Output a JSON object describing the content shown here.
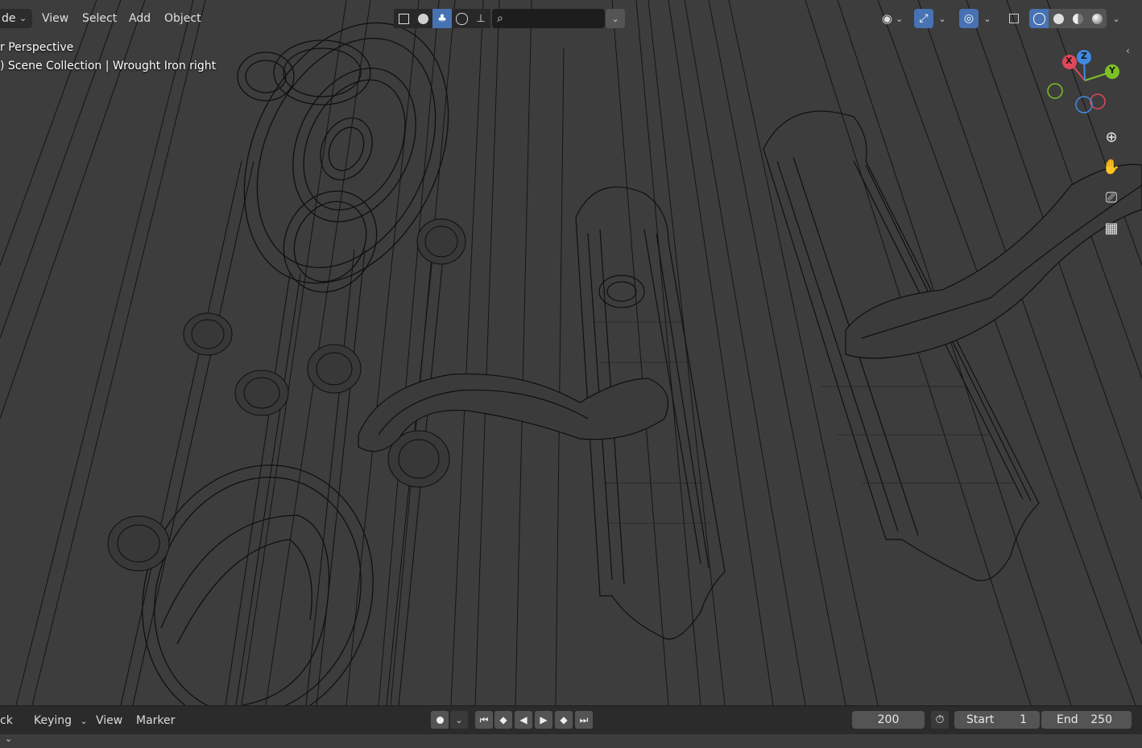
{
  "header": {
    "mode_label": "de",
    "menus": {
      "view": "View",
      "select": "Select",
      "add": "Add",
      "object": "Object"
    },
    "search_placeholder": ""
  },
  "viewport": {
    "perspective_label": "r Perspective",
    "collection_label": ") Scene Collection | Wrought Iron right"
  },
  "gizmo": {
    "x": "X",
    "y": "Y",
    "z": "Z",
    "colors": {
      "x": "#e2475a",
      "y": "#7dc224",
      "z": "#3f8ae0"
    }
  },
  "navigation": {
    "icons": [
      "zoom-icon",
      "hand-icon",
      "camera-icon",
      "grid-icon"
    ]
  },
  "timeline": {
    "mode_label": "ck",
    "keying_label": "Keying",
    "view_label": "View",
    "marker_label": "Marker",
    "current_frame": "200",
    "start_label": "Start",
    "start_value": "1",
    "end_label": "End",
    "end_value": "250"
  },
  "colors": {
    "accent": "#4772b3",
    "background": "#3d3d3d",
    "wire": "#0d0d0d"
  }
}
